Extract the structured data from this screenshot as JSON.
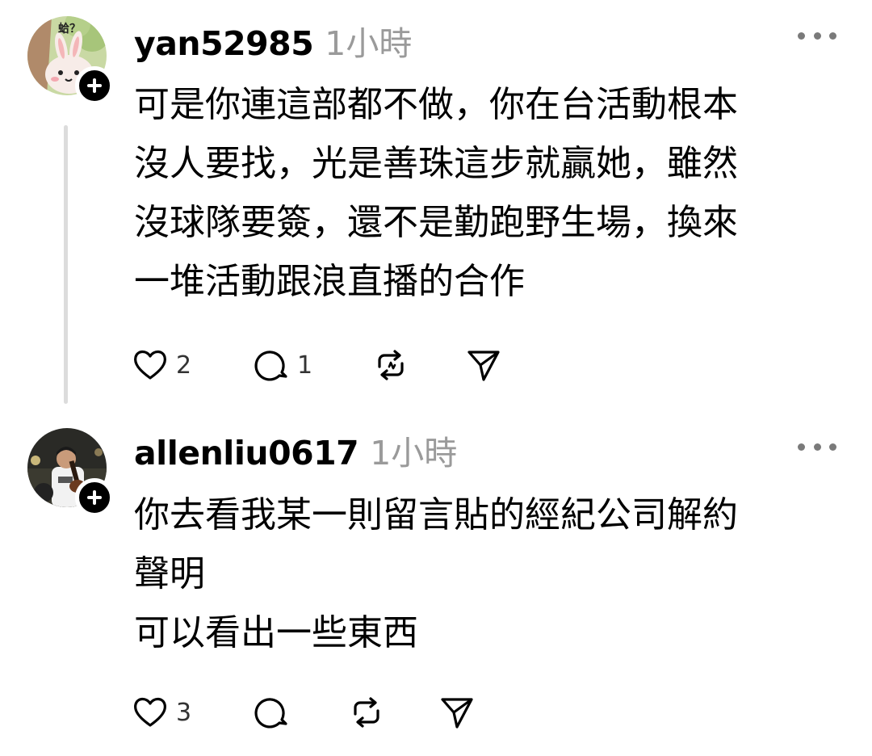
{
  "posts": [
    {
      "username": "yan52985",
      "timestamp": "1小時",
      "avatar_badge_text": "蛤？",
      "text": "可是你連這部都不做，你在台活動根本\n沒人要找，光是善珠這步就贏她，雖然\n沒球隊要簽，還不是勤跑野生場，換來\n一堆活動跟浪直播的合作",
      "likes": "2",
      "replies": "1"
    },
    {
      "username": "allenliu0617",
      "timestamp": "1小時",
      "text": "你去看我某一則留言貼的經紀公司解約\n聲明\n可以看出一些東西",
      "likes": "3",
      "replies": ""
    }
  ],
  "icons": {
    "like": "heart-icon",
    "reply": "comment-icon",
    "repost": "repost-icon",
    "share": "send-icon",
    "more": "more-icon",
    "follow": "plus-icon"
  },
  "colors": {
    "text": "#000000",
    "muted": "#9a9a9a",
    "thread_line": "#dcdcdc",
    "background": "#ffffff"
  }
}
